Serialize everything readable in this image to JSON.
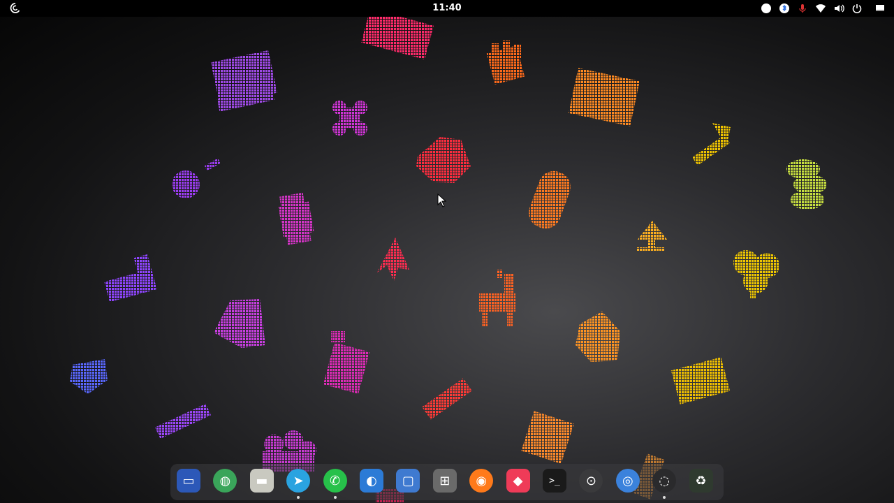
{
  "topbar": {
    "clock": "11:40",
    "tray_icons": [
      "night-light-icon",
      "bluetooth-icon",
      "microphone-icon",
      "wifi-icon",
      "volume-icon",
      "power-icon",
      "screen-icon"
    ]
  },
  "desktop": {
    "wallpaper": "pixel-art-icons-gradient",
    "icon_colors": [
      "#8a3cf0",
      "#d02ec8",
      "#ff2a5a",
      "#ff6a1a",
      "#ff9a1a",
      "#f0c000"
    ]
  },
  "dock": {
    "apps": [
      {
        "name": "Remote Desktop",
        "icon": "monitor-icon",
        "color": "#2c58b8",
        "running": false
      },
      {
        "name": "Earth",
        "icon": "globe-icon",
        "color": "#3aa55a",
        "running": false
      },
      {
        "name": "Files",
        "icon": "folder-icon",
        "color": "#c9c9c0",
        "running": false
      },
      {
        "name": "Telegram",
        "icon": "telegram-icon",
        "color": "#2aa3e0",
        "running": true
      },
      {
        "name": "WhatsApp",
        "icon": "whatsapp-icon",
        "color": "#27c14a",
        "running": true
      },
      {
        "name": "Edge",
        "icon": "edge-icon",
        "color": "#2c7bd6",
        "running": false
      },
      {
        "name": "Workspaces",
        "icon": "window-icon",
        "color": "#3f7ad0",
        "running": false
      },
      {
        "name": "Software",
        "icon": "apps-icon",
        "color": "#6a6a6a",
        "running": false
      },
      {
        "name": "Firefox",
        "icon": "firefox-icon",
        "color": "#ff7a1a",
        "running": false
      },
      {
        "name": "AnyDesk",
        "icon": "anydesk-icon",
        "color": "#ef3b58",
        "running": false
      },
      {
        "name": "Terminal",
        "icon": "terminal-icon",
        "color": "#1a1a1a",
        "running": false
      },
      {
        "name": "Steam",
        "icon": "steam-icon",
        "color": "#3a3a3c",
        "running": false
      },
      {
        "name": "Chromium",
        "icon": "chromium-icon",
        "color": "#3b82dc",
        "running": false
      },
      {
        "name": "OBS",
        "icon": "obs-icon",
        "color": "#2a2a2c",
        "running": true
      },
      {
        "name": "Trash",
        "icon": "trash-icon",
        "color": "#2f3a2f",
        "running": false
      }
    ]
  }
}
